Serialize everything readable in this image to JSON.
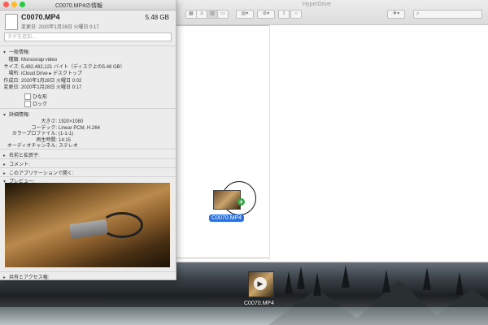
{
  "finder": {
    "title": "HyperDrive"
  },
  "info": {
    "window_title": "C0070.MP4の情報",
    "file_name": "C0070.MP4",
    "file_size": "5.48 GB",
    "modified_line": "変更日: 2020年1月28日 火曜日 0:17",
    "tag_placeholder": "タグを追加...",
    "general_header": "一般情報:",
    "general": [
      {
        "key": "種類:",
        "value": "Monosnap video"
      },
      {
        "key": "サイズ:",
        "value": "5,482,482,121 バイト（ディスク上の5.48 GB）"
      },
      {
        "key": "場所:",
        "value": "iCloud Drive ▸ デスクトップ"
      },
      {
        "key": "作成日:",
        "value": "2020年1月28日 火曜日 0:02"
      },
      {
        "key": "変更日:",
        "value": "2020年1月28日 火曜日 0:17"
      }
    ],
    "stationery_label": "ひな形",
    "locked_label": "ロック",
    "detail_header": "詳細情報:",
    "details": [
      {
        "key": "大きさ:",
        "value": "1920×1080"
      },
      {
        "key": "コーデック:",
        "value": "Linear PCM, H.264"
      },
      {
        "key": "カラープロファイル:",
        "value": "(1-1-1)"
      },
      {
        "key": "再生時間:",
        "value": "14:15"
      },
      {
        "key": "オーディオチャンネル:",
        "value": "ステレオ"
      }
    ],
    "name_ext_header": "名前と拡張子:",
    "comments_header": "コメント:",
    "open_with_header": "このアプリケーションで開く:",
    "preview_header": "プレビュー:",
    "sharing_header": "共有とアクセス権:"
  },
  "drag": {
    "label": "C0070.MP4"
  },
  "desktop": {
    "label": "C0070.MP4"
  },
  "icons": [
    "file-icon",
    "gear-icon",
    "share-icon",
    "dropbox-icon",
    "search-icon",
    "plus-icon",
    "play-icon"
  ]
}
